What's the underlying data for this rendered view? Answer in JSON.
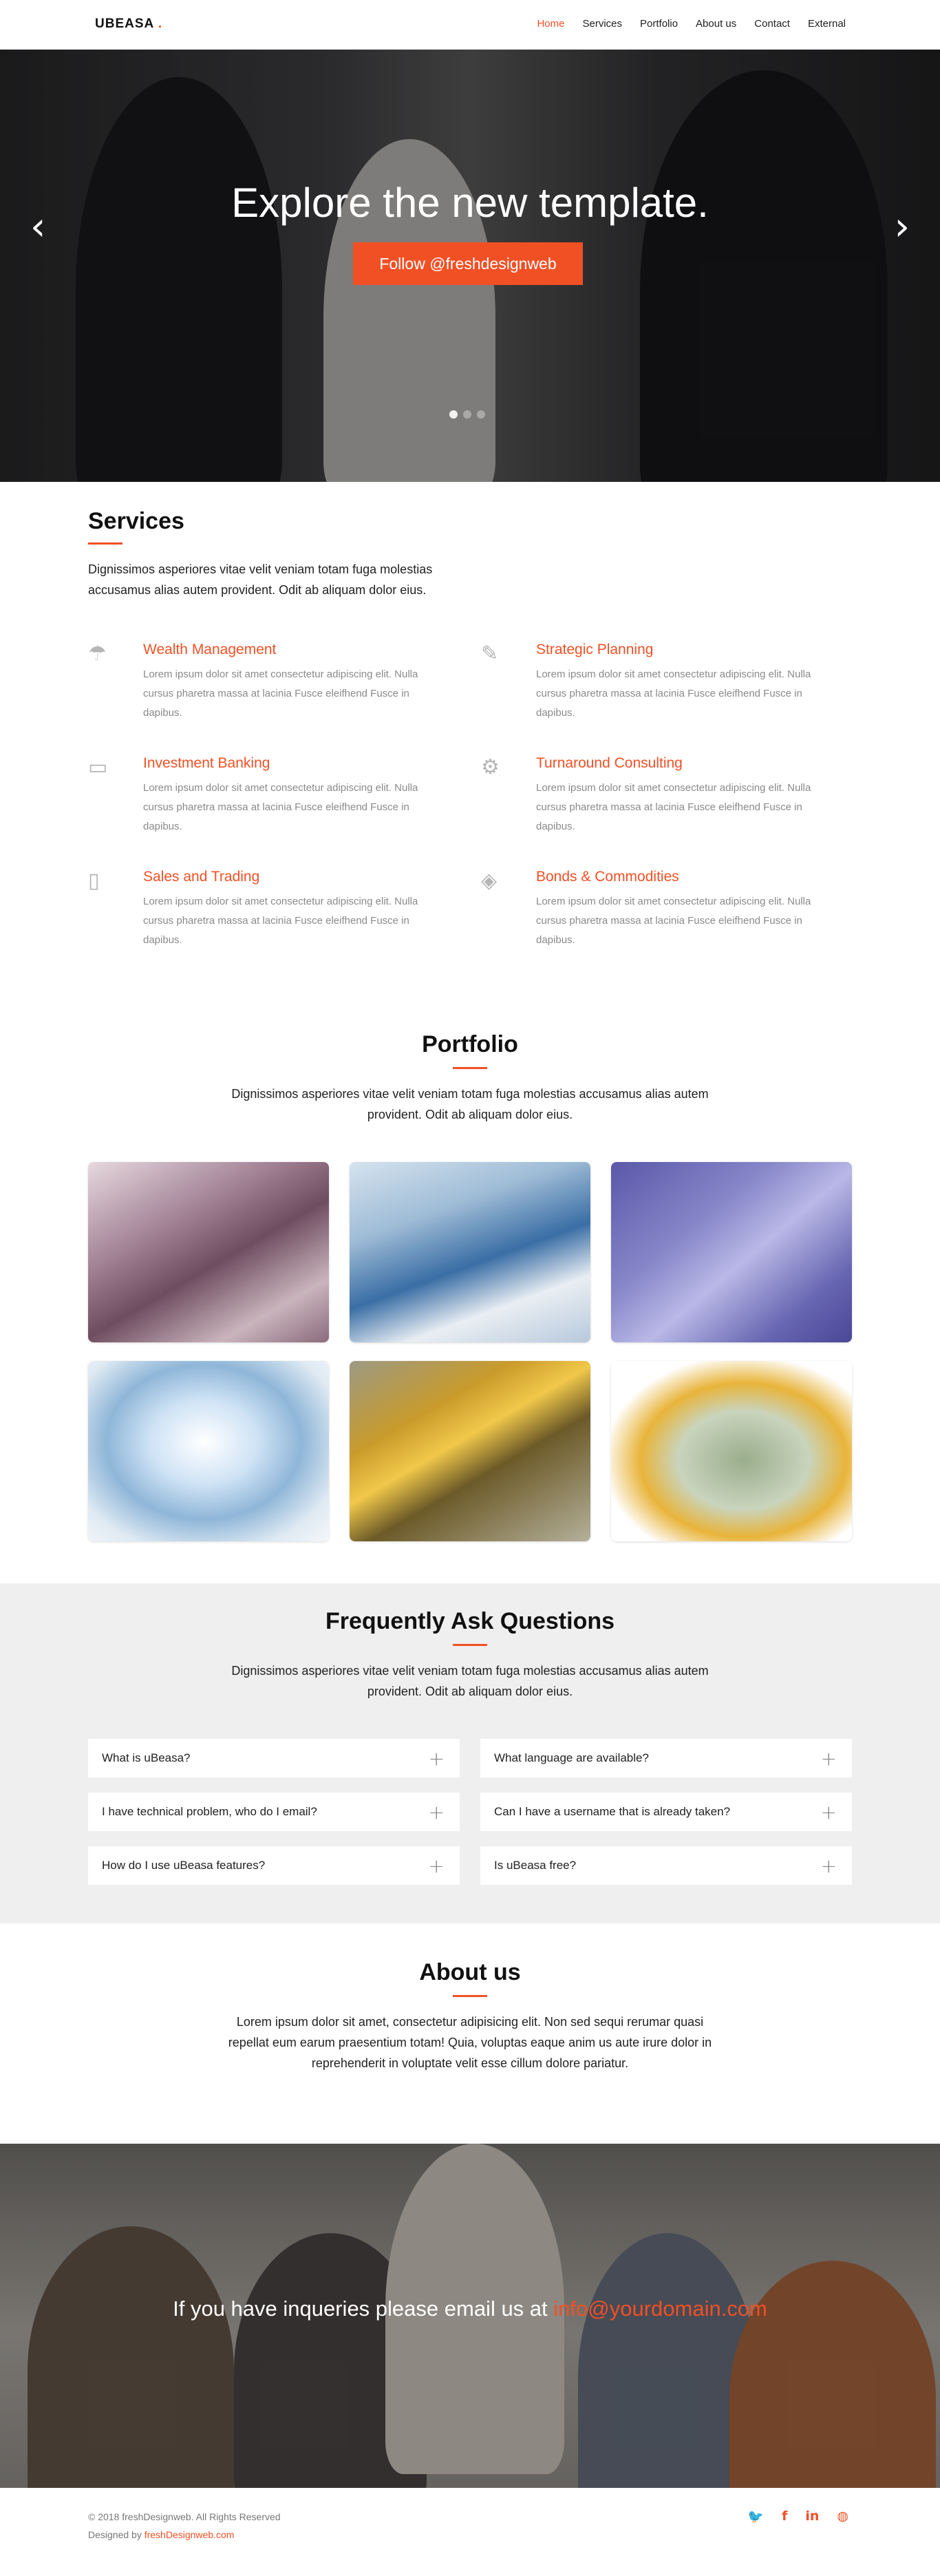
{
  "nav": {
    "logo": "UBEASA",
    "logo_dot": ".",
    "items": [
      {
        "label": "Home",
        "active": true
      },
      {
        "label": "Services",
        "active": false
      },
      {
        "label": "Portfolio",
        "active": false
      },
      {
        "label": "About us",
        "active": false
      },
      {
        "label": "Contact",
        "active": false
      },
      {
        "label": "External",
        "active": false
      }
    ]
  },
  "hero": {
    "title": "Explore the new template.",
    "cta": "Follow @freshdesignweb",
    "prev_icon": "chevron-left-icon",
    "next_icon": "chevron-right-icon",
    "slides": 3,
    "active_slide": 1
  },
  "services": {
    "title": "Services",
    "intro": "Dignissimos asperiores vitae velit veniam totam fuga molestias accusamus alias autem provident. Odit ab aliquam dolor eius.",
    "items": [
      {
        "title": "Wealth Management",
        "icon": "umbrella-icon",
        "text": "Lorem ipsum dolor sit amet consectetur adipiscing elit. Nulla cursus pharetra massa at lacinia Fusce eleifhend Fusce in dapibus."
      },
      {
        "title": "Strategic Planning",
        "icon": "pencil-icon",
        "text": "Lorem ipsum dolor sit amet consectetur adipiscing elit. Nulla cursus pharetra massa at lacinia Fusce eleifhend Fusce in dapibus."
      },
      {
        "title": "Investment Banking",
        "icon": "monitor-icon",
        "text": "Lorem ipsum dolor sit amet consectetur adipiscing elit. Nulla cursus pharetra massa at lacinia Fusce eleifhend Fusce in dapibus."
      },
      {
        "title": "Turnaround Consulting",
        "icon": "gear-icon",
        "text": "Lorem ipsum dolor sit amet consectetur adipiscing elit. Nulla cursus pharetra massa at lacinia Fusce eleifhend Fusce in dapibus."
      },
      {
        "title": "Sales and Trading",
        "icon": "trash-can-icon",
        "text": "Lorem ipsum dolor sit amet consectetur adipiscing elit. Nulla cursus pharetra massa at lacinia Fusce eleifhend Fusce in dapibus."
      },
      {
        "title": "Bonds & Commodities",
        "icon": "layers-icon",
        "text": "Lorem ipsum dolor sit amet consectetur adipiscing elit. Nulla cursus pharetra massa at lacinia Fusce eleifhend Fusce in dapibus."
      }
    ]
  },
  "portfolio": {
    "title": "Portfolio",
    "intro": "Dignissimos asperiores vitae velit veniam totam fuga molestias accusamus alias autem provident. Odit ab aliquam dolor eius.",
    "items": [
      {
        "name": "banknote-closeup"
      },
      {
        "name": "business-charts-handshake"
      },
      {
        "name": "credit-card-padlock"
      },
      {
        "name": "diamond"
      },
      {
        "name": "gold-bars-on-dollars"
      },
      {
        "name": "money-stack-chain-lock"
      }
    ]
  },
  "faq": {
    "title": "Frequently Ask Questions",
    "intro": "Dignissimos asperiores vitae velit veniam totam fuga molestias accusamus alias autem provident. Odit ab aliquam dolor eius.",
    "items": [
      {
        "q": "What is uBeasa?"
      },
      {
        "q": "What language are available?"
      },
      {
        "q": "I have technical problem, who do I email?"
      },
      {
        "q": "Can I have a username that is already taken?"
      },
      {
        "q": "How do I use uBeasa features?"
      },
      {
        "q": "Is uBeasa free?"
      }
    ],
    "expand_icon": "plus-icon"
  },
  "about": {
    "title": "About us",
    "text": "Lorem ipsum dolor sit amet, consectetur adipisicing elit. Non sed sequi rerumar quasi repellat eum earum praesentium totam! Quia, voluptas eaque anim us aute irure dolor in reprehenderit in voluptate velit esse cillum dolore pariatur."
  },
  "contact": {
    "text": "If you have inqueries please email us at ",
    "email": "info@yourdomain.com"
  },
  "footer": {
    "copyright": "© 2018 freshDesignweb. All Rights Reserved",
    "designed_by": "Designed by ",
    "designer_link": "freshDesignweb.com",
    "social": [
      "twitter-icon",
      "facebook-icon",
      "linkedin-icon",
      "dribbble-icon"
    ]
  },
  "colors": {
    "accent": "#f15025",
    "faq_bg": "#efefef"
  }
}
